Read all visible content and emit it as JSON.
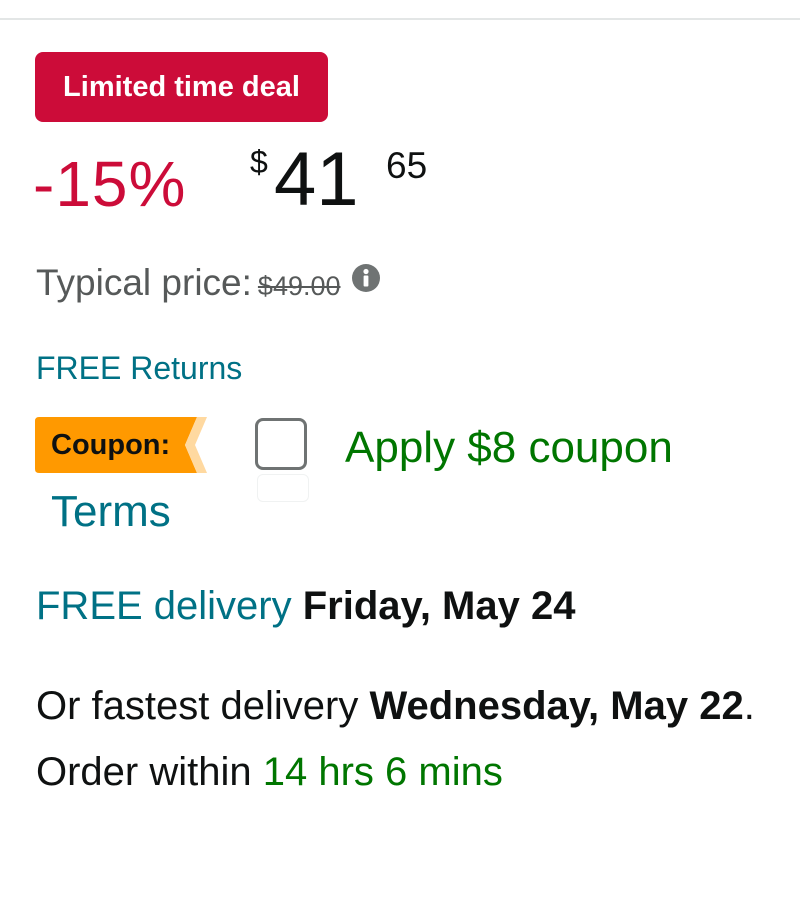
{
  "deal_badge": {
    "label": "Limited time deal"
  },
  "price": {
    "discount": "-15%",
    "currency_symbol": "$",
    "whole": "41",
    "fraction": "65"
  },
  "typical_price": {
    "label": "Typical price:",
    "value": "$49.00",
    "icon": "info-icon"
  },
  "free_returns": {
    "label": "FREE Returns"
  },
  "coupon": {
    "tag_label": "Coupon:",
    "apply_label": "Apply $8 coupon",
    "terms_label": "Terms",
    "checked": false
  },
  "delivery": {
    "free_label": "FREE delivery",
    "date": "Friday, May 24"
  },
  "fastest_delivery": {
    "prefix": "Or fastest delivery",
    "date": "Wednesday, May 22",
    "order_within_label": ". Order within",
    "countdown": "14 hrs 6 mins"
  },
  "colors": {
    "deal_red": "#cc0c39",
    "link_teal": "#007185",
    "coupon_green": "#007600",
    "coupon_orange": "#ff9900",
    "text_dark": "#0f1111",
    "text_gray": "#565959"
  }
}
